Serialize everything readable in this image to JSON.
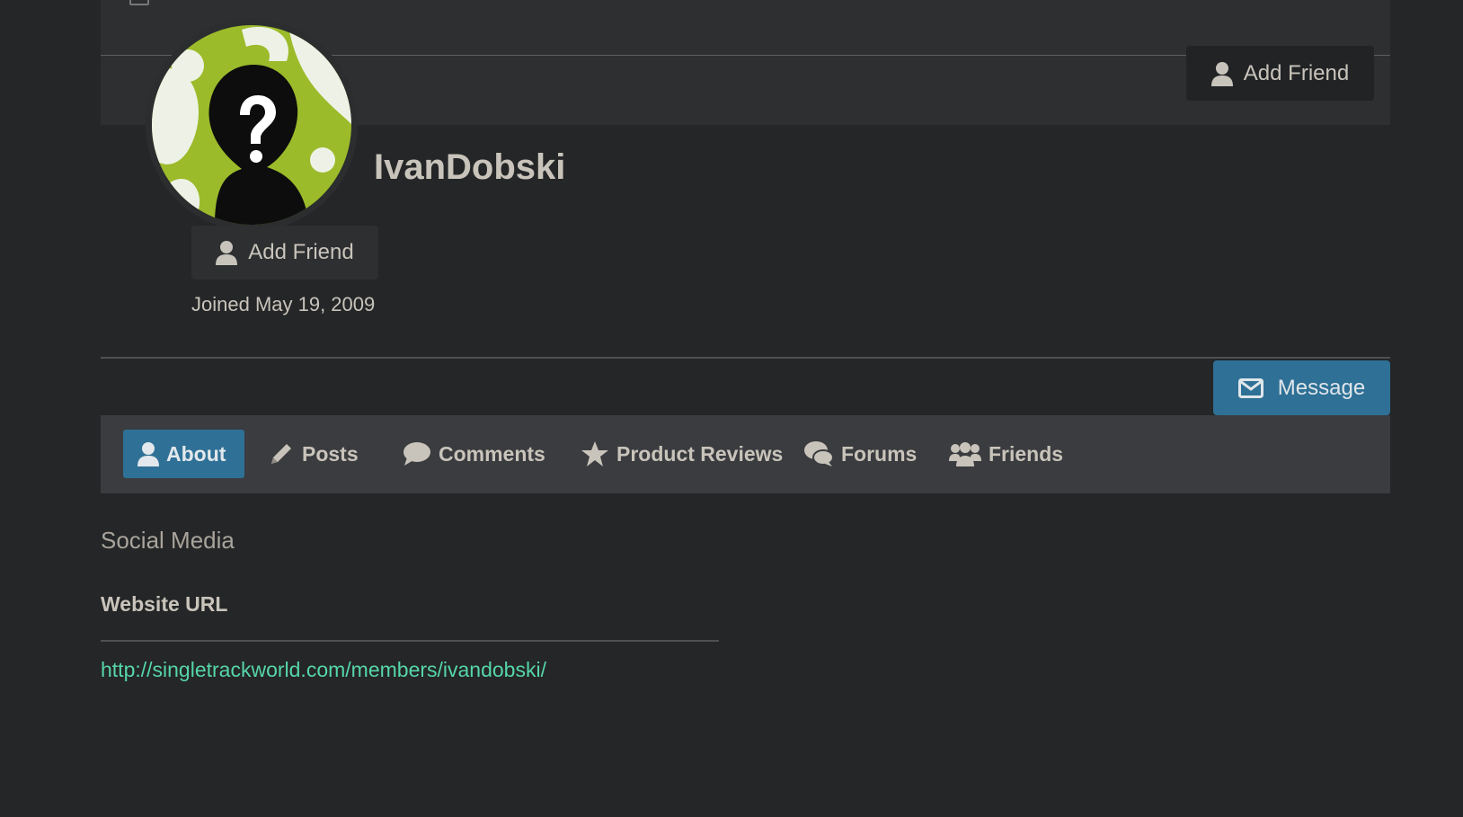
{
  "profile": {
    "username": "IvanDobski",
    "joined": "Joined May 19, 2009",
    "add_friend_label": "Add Friend"
  },
  "cover": {
    "add_friend_label": "Add Friend"
  },
  "actions": {
    "message_label": "Message"
  },
  "tabs": [
    {
      "label": "About",
      "icon": "user-icon",
      "active": true
    },
    {
      "label": "Posts",
      "icon": "pencil-icon",
      "active": false
    },
    {
      "label": "Comments",
      "icon": "comment-bubble-icon",
      "active": false
    },
    {
      "label": "Product Reviews",
      "icon": "star-icon",
      "active": false
    },
    {
      "label": "Forums",
      "icon": "chat-bubbles-icon",
      "active": false
    },
    {
      "label": "Friends",
      "icon": "users-icon",
      "active": false
    }
  ],
  "about": {
    "section_title": "Social Media",
    "website_label": "Website URL",
    "website_url": "http://singletrackworld.com/members/ivandobski/"
  },
  "colors": {
    "background": "#242627",
    "accent": "#2f7096",
    "link": "#56d6a8",
    "avatar_green": "#9bbb2a"
  }
}
